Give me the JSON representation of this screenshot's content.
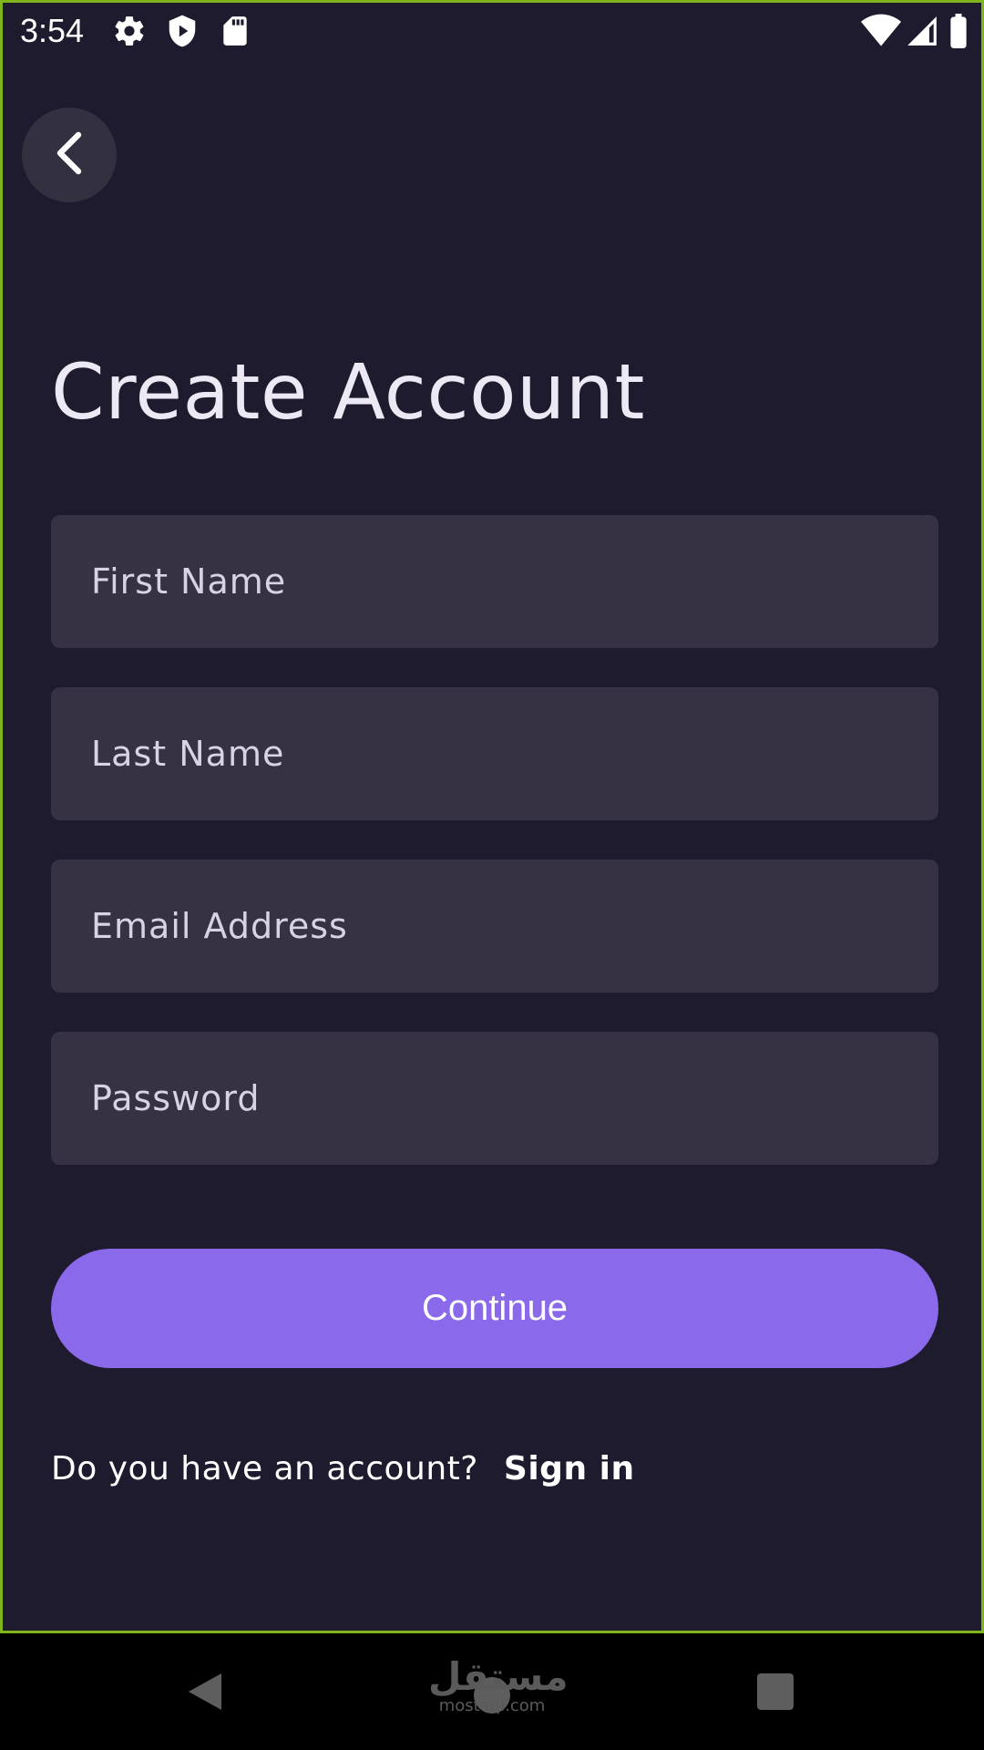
{
  "status_bar": {
    "time": "3:54",
    "left_icons": [
      "gear-icon",
      "shield-icon",
      "sd-card-icon"
    ],
    "right_icons": [
      "wifi-icon",
      "signal-icon",
      "battery-icon"
    ]
  },
  "header": {
    "back_icon": "chevron-left-icon"
  },
  "page": {
    "title": "Create Account"
  },
  "form": {
    "first_name_placeholder": "First Name",
    "last_name_placeholder": "Last Name",
    "email_placeholder": "Email Address",
    "password_placeholder": "Password",
    "continue_label": "Continue"
  },
  "footer": {
    "prompt": "Do you have an account?",
    "signin_label": "Sign in"
  },
  "watermark": {
    "main": "مستقل",
    "sub": "mostaql.com"
  },
  "nav_bar": {
    "icons": [
      "back-triangle-icon",
      "home-circle-icon",
      "recents-square-icon"
    ]
  },
  "colors": {
    "background": "#1f1b2e",
    "field": "#363143",
    "accent": "#8a69ea",
    "back_button": "#33303f"
  }
}
